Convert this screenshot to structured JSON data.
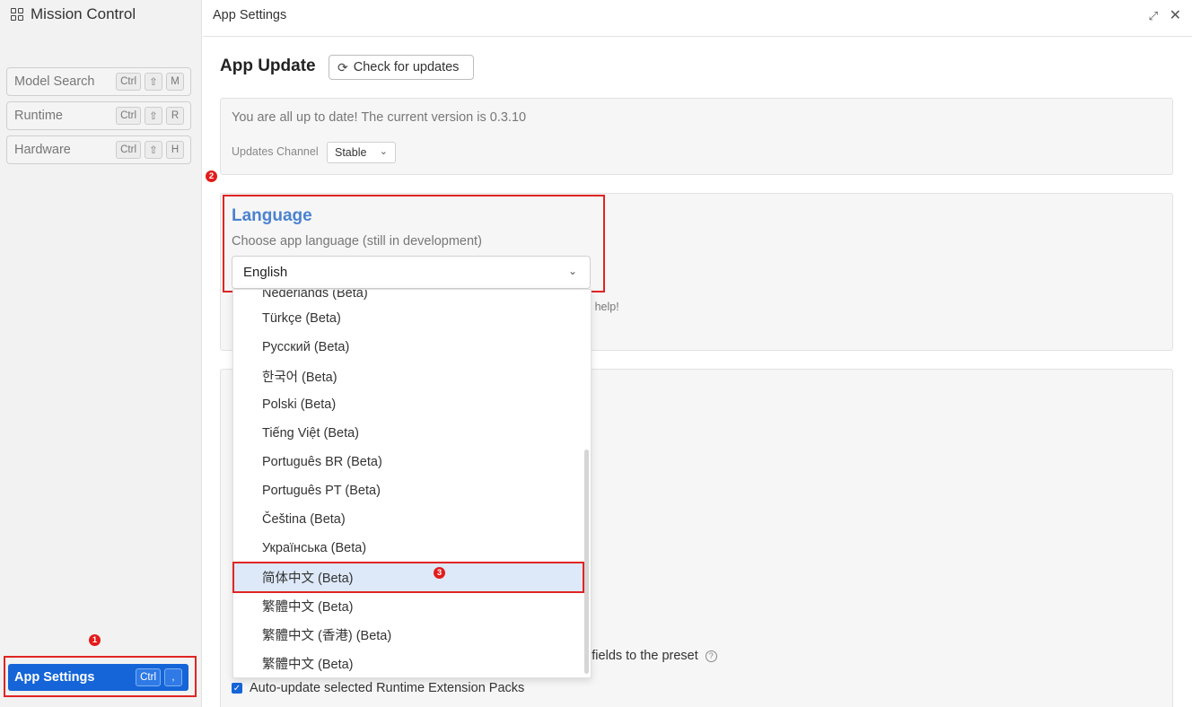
{
  "sidebar": {
    "title": "Mission Control",
    "nav": [
      {
        "label": "Model Search",
        "keys": [
          "Ctrl",
          "⇧",
          "M"
        ]
      },
      {
        "label": "Runtime",
        "keys": [
          "Ctrl",
          "⇧",
          "R"
        ]
      },
      {
        "label": "Hardware",
        "keys": [
          "Ctrl",
          "⇧",
          "H"
        ]
      }
    ],
    "app_settings": {
      "label": "App Settings",
      "keys": [
        "Ctrl",
        ","
      ]
    }
  },
  "header": {
    "title": "App Settings"
  },
  "app_update": {
    "heading": "App Update",
    "check_label": "Check for updates",
    "status": "You are all up to date! The current version is 0.3.10",
    "channel_label": "Updates Channel",
    "channel_value": "Stable"
  },
  "language": {
    "heading": "Language",
    "subtitle": "Choose app language (still in development)",
    "selected": "English",
    "help_fragment": "ur help!",
    "options": [
      "Nederlands (Beta)",
      "Türkçe (Beta)",
      "Русский (Beta)",
      "한국어 (Beta)",
      "Polski (Beta)",
      "Tiếng Việt (Beta)",
      "Português BR (Beta)",
      "Português PT (Beta)",
      "Čeština (Beta)",
      "Українська (Beta)",
      "简体中文 (Beta)",
      "繁體中文 (Beta)",
      "繁體中文 (香港) (Beta)",
      "繁體中文 (Beta)"
    ],
    "highlighted_index": 10
  },
  "bottom": {
    "preset_fragment": "v fields to the preset",
    "auto_update_label": "Auto-update selected Runtime Extension Packs"
  },
  "markers": [
    "1",
    "2",
    "3"
  ]
}
